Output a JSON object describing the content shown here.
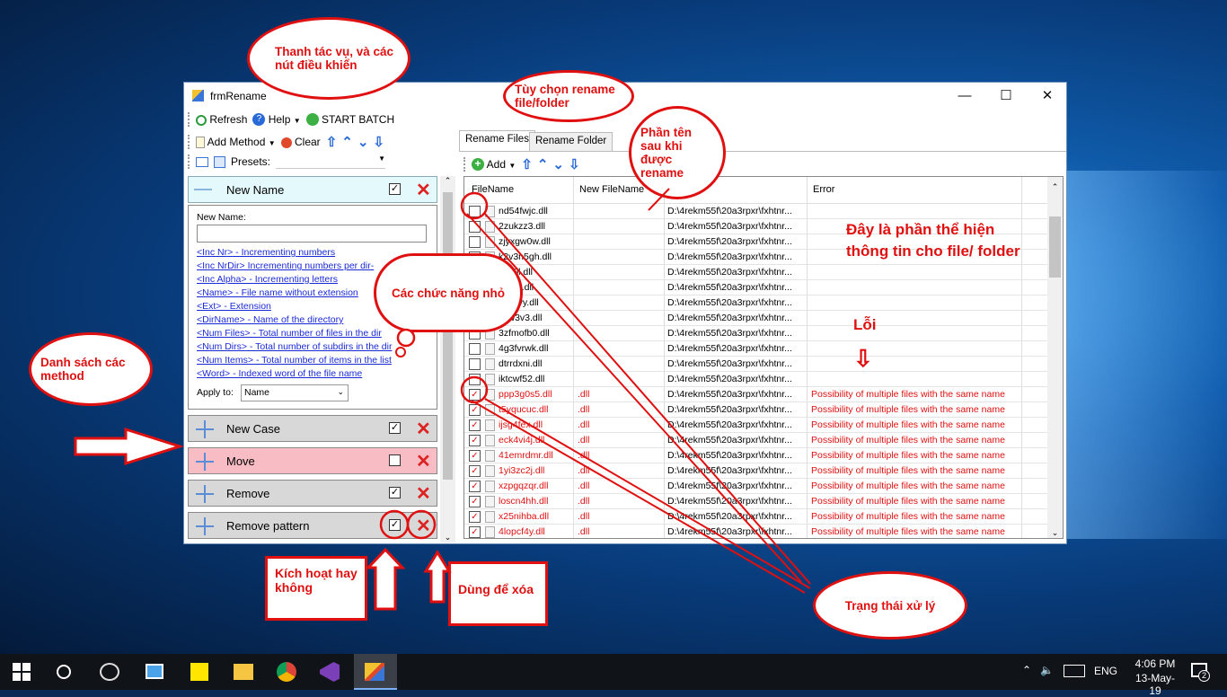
{
  "window": {
    "title": "frmRename"
  },
  "toolbar": {
    "refresh": "Refresh",
    "help": "Help",
    "start_batch": "START BATCH"
  },
  "method_bar": {
    "add_method": "Add Method",
    "clear": "Clear",
    "presets_label": "Presets:"
  },
  "methods": [
    {
      "name": "New Name",
      "enabled": true
    },
    {
      "name": "New Case",
      "enabled": true
    },
    {
      "name": "Move",
      "enabled": false
    },
    {
      "name": "Remove",
      "enabled": true
    },
    {
      "name": "Remove pattern",
      "enabled": true
    }
  ],
  "new_name_panel": {
    "label": "New Name:",
    "input_value": "",
    "links": [
      "<Inc Nr> - Incrementing numbers",
      "<Inc NrDir> Incrementing numbers per dir-",
      "<Inc Alpha> - Incrementing letters",
      "<Name> - File name without extension",
      "<Ext> - Extension",
      "<DirName> - Name of the directory",
      "<Num Files> - Total number of files in the dir",
      "<Num Dirs> - Total number of subdirs in the dir",
      "<Num Items> - Total number of items in the list",
      "<Word> - Indexed word of the file name"
    ],
    "apply_to_label": "Apply to:",
    "apply_to_value": "Name"
  },
  "tabs": {
    "files": "Rename Files",
    "folder": "Rename Folder"
  },
  "grid_toolbar": {
    "add": "Add"
  },
  "grid": {
    "columns": [
      "FileName",
      "New FileName",
      "",
      "Error"
    ],
    "rows": [
      {
        "checked": false,
        "name": "nd54fwjc.dll",
        "new": "",
        "path": "D:\\4rekm55f\\20a3rpxr\\fxhtnr...",
        "error": ""
      },
      {
        "checked": false,
        "name": "2zukzz3.dll",
        "new": "",
        "path": "D:\\4rekm55f\\20a3rpxr\\fxhtnr...",
        "error": ""
      },
      {
        "checked": false,
        "name": "zjyxgw0w.dll",
        "new": "",
        "path": "D:\\4rekm55f\\20a3rpxr\\fxhtnr...",
        "error": ""
      },
      {
        "checked": false,
        "name": "k2v3n5gh.dll",
        "new": "",
        "path": "D:\\4rekm55f\\20a3rpxr\\fxhtnr...",
        "error": ""
      },
      {
        "checked": false,
        "name": "kjfp0l.dll",
        "new": "",
        "path": "D:\\4rekm55f\\20a3rpxr\\fxhtnr...",
        "error": ""
      },
      {
        "checked": false,
        "name": "ef5vb.dll",
        "new": "",
        "path": "D:\\4rekm55f\\20a3rpxr\\fxhtnr...",
        "error": ""
      },
      {
        "checked": false,
        "name": "zwf3vy.dll",
        "new": "",
        "path": "D:\\4rekm55f\\20a3rpxr\\fxhtnr...",
        "error": ""
      },
      {
        "checked": false,
        "name": "xxw3v3.dll",
        "new": "",
        "path": "D:\\4rekm55f\\20a3rpxr\\fxhtnr...",
        "error": ""
      },
      {
        "checked": false,
        "name": "3zfmofb0.dll",
        "new": "",
        "path": "D:\\4rekm55f\\20a3rpxr\\fxhtnr...",
        "error": ""
      },
      {
        "checked": false,
        "name": "4g3fvrwk.dll",
        "new": "",
        "path": "D:\\4rekm55f\\20a3rpxr\\fxhtnr...",
        "error": ""
      },
      {
        "checked": false,
        "name": "dtrrdxni.dll",
        "new": "",
        "path": "D:\\4rekm55f\\20a3rpxr\\fxhtnr...",
        "error": ""
      },
      {
        "checked": false,
        "name": "iktcwf52.dll",
        "new": "",
        "path": "D:\\4rekm55f\\20a3rpxr\\fxhtnr...",
        "error": ""
      },
      {
        "checked": true,
        "name": "ppp3g0s5.dll",
        "new": ".dll",
        "path": "D:\\4rekm55f\\20a3rpxr\\fxhtnr...",
        "error": "Possibility of multiple files with the same name"
      },
      {
        "checked": true,
        "name": "t5yqucuc.dll",
        "new": ".dll",
        "path": "D:\\4rekm55f\\20a3rpxr\\fxhtnr...",
        "error": "Possibility of multiple files with the same name"
      },
      {
        "checked": true,
        "name": "ijsg4fex.dll",
        "new": ".dll",
        "path": "D:\\4rekm55f\\20a3rpxr\\fxhtnr...",
        "error": "Possibility of multiple files with the same name"
      },
      {
        "checked": true,
        "name": "eck4vi4j.dll",
        "new": ".dll",
        "path": "D:\\4rekm55f\\20a3rpxr\\fxhtnr...",
        "error": "Possibility of multiple files with the same name"
      },
      {
        "checked": true,
        "name": "41emrdmr.dll",
        "new": ".dll",
        "path": "D:\\4rekm55f\\20a3rpxr\\fxhtnr...",
        "error": "Possibility of multiple files with the same name"
      },
      {
        "checked": true,
        "name": "1yi3zc2j.dll",
        "new": ".dll",
        "path": "D:\\4rekm55f\\20a3rpxr\\fxhtnr...",
        "error": "Possibility of multiple files with the same name"
      },
      {
        "checked": true,
        "name": "xzpgqzqr.dll",
        "new": ".dll",
        "path": "D:\\4rekm55f\\20a3rpxr\\fxhtnr...",
        "error": "Possibility of multiple files with the same name"
      },
      {
        "checked": true,
        "name": "loscn4hh.dll",
        "new": ".dll",
        "path": "D:\\4rekm55f\\20a3rpxr\\fxhtnr...",
        "error": "Possibility of multiple files with the same name"
      },
      {
        "checked": true,
        "name": "x25nihba.dll",
        "new": ".dll",
        "path": "D:\\4rekm55f\\20a3rpxr\\fxhtnr...",
        "error": "Possibility of multiple files with the same name"
      },
      {
        "checked": true,
        "name": "4lopcf4y.dll",
        "new": ".dll",
        "path": "D:\\4rekm55f\\20a3rpxr\\fxhtnr...",
        "error": "Possibility of multiple files with the same name"
      }
    ]
  },
  "annotations": {
    "toolbar_note": "Thanh tác vụ, và các nút điều khiển",
    "options_note": "Tùy chọn rename file/folder",
    "renamed_note": "Phần tên sau khi được rename",
    "info_note": "Đây là phần thể hiện thông tin cho file/ folder",
    "error_note": "Lỗi",
    "functions_note": "Các chức năng nhỏ",
    "methods_note": "Danh sách các method",
    "activate_note": "Kích hoạt hay không",
    "delete_note": "Dùng để xóa",
    "status_note": "Trạng thái xử lý"
  },
  "taskbar": {
    "lang": "ENG",
    "time": "4:06 PM",
    "date": "13-May-19",
    "notif_count": "2"
  },
  "colors": {
    "error": "#e01010",
    "link": "#1a2ad8",
    "accent": "#2a6ad8"
  }
}
